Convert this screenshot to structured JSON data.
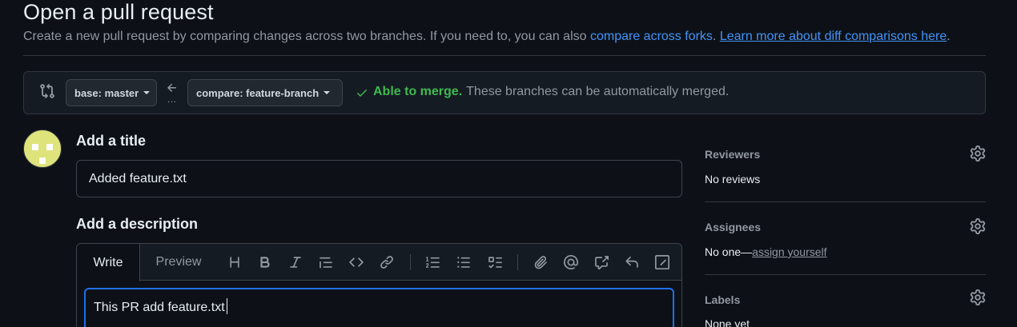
{
  "header": {
    "title": "Open a pull request",
    "subtitle_text": "Create a new pull request by comparing changes across two branches. If you need to, you can also ",
    "compare_forks_link": "compare across forks",
    "period1": ".",
    "learn_more_link": "Learn more about diff comparisons here",
    "period2": "."
  },
  "range": {
    "base_label": "base: master",
    "compare_label": "compare: feature-branch",
    "ellipsis": "...",
    "merge_ok": "Able to merge.",
    "merge_text": "These branches can be automatically merged.",
    "status_color": "#3fb950"
  },
  "form": {
    "title_label": "Add a title",
    "title_value": "Added feature.txt",
    "description_label": "Add a description",
    "tabs": [
      "Write",
      "Preview"
    ],
    "toolbar": [
      "heading-icon",
      "bold-icon",
      "italic-icon",
      "quote-icon",
      "code-icon",
      "link-icon",
      "ordered-list-icon",
      "unordered-list-icon",
      "task-list-icon",
      "attach-icon",
      "mention-icon",
      "cross-reference-icon",
      "reply-icon",
      "slash-command-icon"
    ],
    "description_value": "This PR add feature.txt"
  },
  "sidebar": {
    "reviewers": {
      "label": "Reviewers",
      "value": "No reviews"
    },
    "assignees": {
      "label": "Assignees",
      "value": "No one—",
      "link": "assign yourself"
    },
    "labels": {
      "label": "Labels",
      "value": "None yet"
    }
  },
  "colors": {
    "accent": "#4493f8",
    "background": "#0d1117",
    "success": "#3fb950",
    "focus": "#1f6feb"
  }
}
